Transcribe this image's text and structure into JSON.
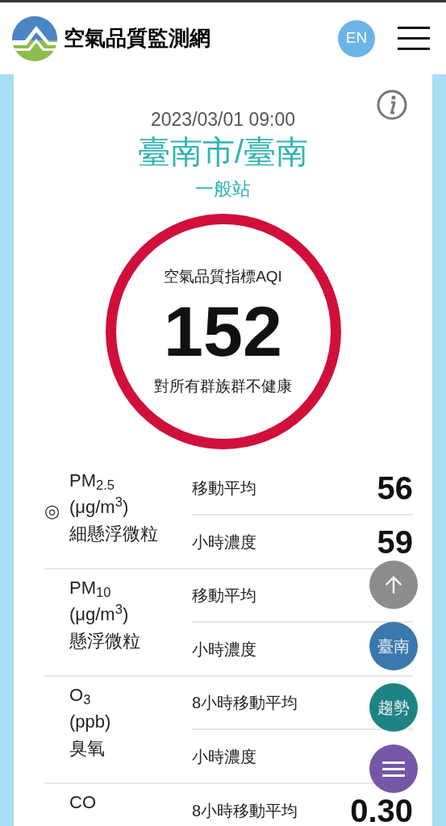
{
  "header": {
    "title": "空氣品質監測網",
    "language_button": "EN"
  },
  "station": {
    "datetime": "2023/03/01 09:00",
    "name": "臺南市/臺南",
    "type": "一般站"
  },
  "aqi": {
    "label": "空氣品質指標AQI",
    "value": "152",
    "status": "對所有群族群不健康",
    "color": "#d0103a"
  },
  "pollutants": [
    {
      "name": "PM$_{2.5}$",
      "unit": "(μg/m$^{3}$)",
      "description": "細懸浮微粒",
      "marker": "◎",
      "readings": [
        {
          "label": "移動平均",
          "value": "56"
        },
        {
          "label": "小時濃度",
          "value": "59"
        }
      ]
    },
    {
      "name": "PM$_{10}$",
      "unit": "(μg/m$^{3}$)",
      "description": "懸浮微粒",
      "readings": [
        {
          "label": "移動平均"
        },
        {
          "label": "小時濃度"
        }
      ]
    },
    {
      "name": "O$_{3}$",
      "unit": "(ppb)",
      "description": "臭氧",
      "readings": [
        {
          "label": "8小時移動平均"
        },
        {
          "label": "小時濃度"
        }
      ]
    },
    {
      "name": "CO",
      "readings": [
        {
          "label": "8小時移動平均",
          "value": "0.30"
        }
      ]
    }
  ],
  "floating_buttons": [
    {
      "kind": "up",
      "color": "#8c8c8c"
    },
    {
      "kind": "text",
      "label": "臺南",
      "color": "#3b78ad"
    },
    {
      "kind": "text",
      "label": "趨勢",
      "color": "#1d8383"
    },
    {
      "kind": "menu",
      "color": "#7457a6"
    }
  ]
}
